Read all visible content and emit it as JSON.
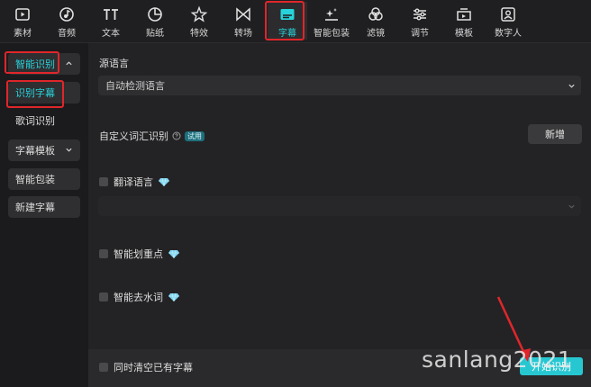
{
  "toolbar": {
    "items": [
      {
        "label": "素材",
        "icon": "media-icon"
      },
      {
        "label": "音频",
        "icon": "audio-icon"
      },
      {
        "label": "文本",
        "icon": "text-icon"
      },
      {
        "label": "贴纸",
        "icon": "sticker-icon"
      },
      {
        "label": "特效",
        "icon": "effects-icon"
      },
      {
        "label": "转场",
        "icon": "transition-icon"
      },
      {
        "label": "字幕",
        "icon": "caption-icon"
      },
      {
        "label": "智能包装",
        "icon": "smart-pack-icon"
      },
      {
        "label": "滤镜",
        "icon": "filter-icon"
      },
      {
        "label": "调节",
        "icon": "adjust-icon"
      },
      {
        "label": "模板",
        "icon": "template-icon"
      },
      {
        "label": "数字人",
        "icon": "digital-human-icon"
      }
    ],
    "active": "字幕"
  },
  "sidebar": {
    "smart_recognition": "智能识别",
    "recognize_caption": "识别字幕",
    "lyrics_recognition": "歌词识别",
    "caption_template": "字幕模板",
    "smart_pack": "智能包装",
    "new_caption": "新建字幕"
  },
  "main": {
    "source_language_label": "源语言",
    "source_language_value": "自动检测语言",
    "custom_vocab_label": "自定义词汇识别",
    "trial_badge": "试用",
    "add_button": "新增",
    "translate_label": "翻译语言",
    "highlight_label": "智能划重点",
    "filler_label": "智能去水词",
    "clear_existing_label": "同时清空已有字幕",
    "start_button": "开始识别"
  },
  "watermark": "sanlang2021",
  "colors": {
    "accent": "#27d2db",
    "highlight_red": "#e0262b",
    "gem": "#7fd6f2"
  }
}
